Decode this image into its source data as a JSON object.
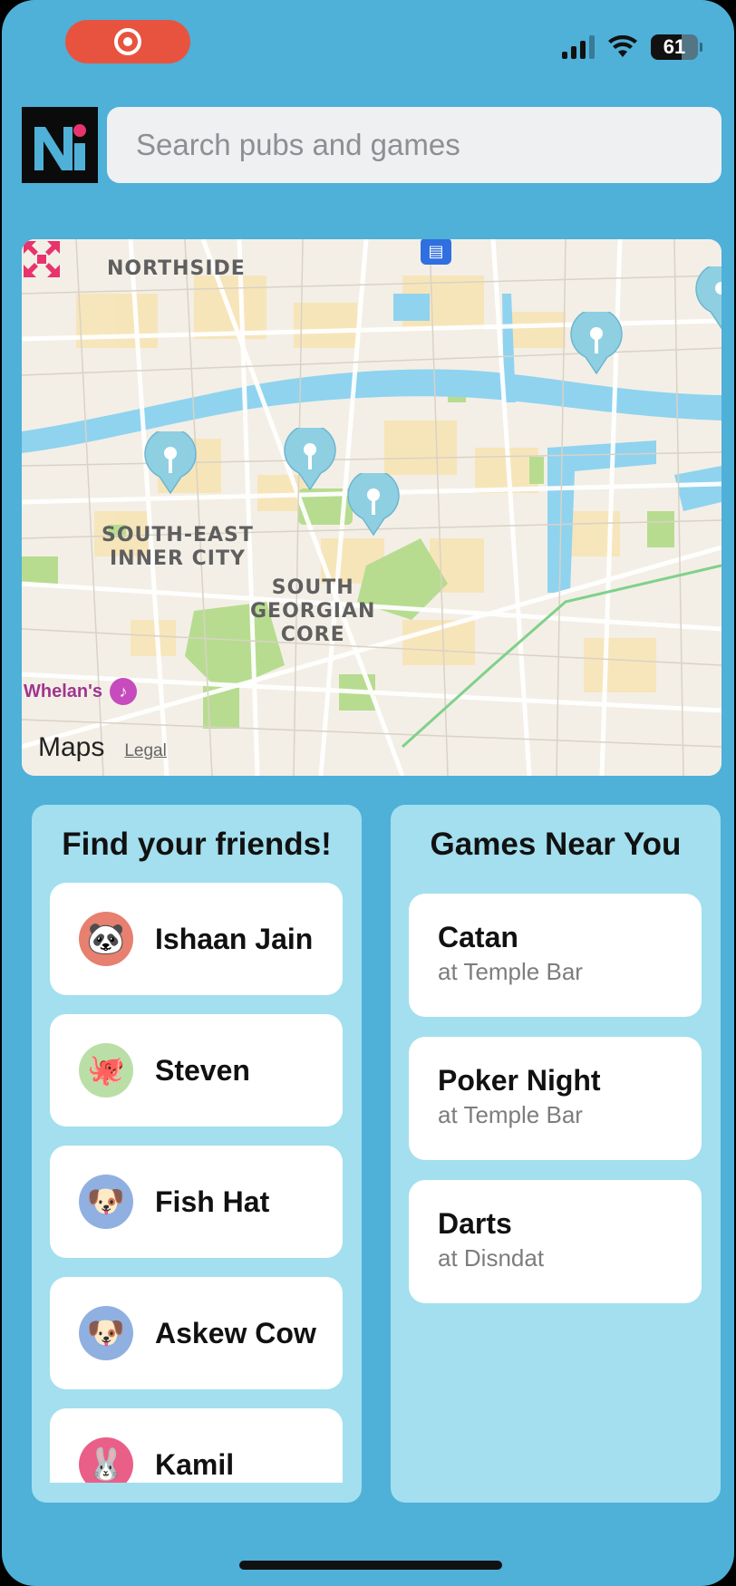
{
  "status_bar": {
    "recording_icon": "record-icon",
    "battery_level": "61",
    "signal_icon": "cellular-signal-icon",
    "wifi_icon": "wifi-icon"
  },
  "header": {
    "logo_icon": "app-logo-icon",
    "search_placeholder": "Search pubs and games"
  },
  "map": {
    "labels": {
      "northside": "NORTHSIDE",
      "south_east_line1": "SOUTH-EAST",
      "south_east_line2": "INNER CITY",
      "south_line1": "SOUTH",
      "south_line2": "GEORGIAN",
      "south_line3": "CORE"
    },
    "venue_label": "Whelan's",
    "brand": "Maps",
    "legal": "Legal",
    "pin_icon": "map-pin-icon",
    "expand_icon": "expand-icon",
    "colors": {
      "water": "#8fd3ef",
      "park": "#b7dc8f",
      "land": "#f3efe6",
      "road": "#ffffff"
    }
  },
  "friends": {
    "title": "Find your friends!",
    "items": [
      {
        "name": "Ishaan Jain",
        "avatar": "🐼",
        "avatar_bg": "#e7806f"
      },
      {
        "name": "Steven",
        "avatar": "🐙",
        "avatar_bg": "#b9dfa7"
      },
      {
        "name": "Fish Hat",
        "avatar": "🐶",
        "avatar_bg": "#8fb0e0"
      },
      {
        "name": "Askew Cow",
        "avatar": "🐶",
        "avatar_bg": "#8fb0e0"
      },
      {
        "name": "Kamil",
        "avatar": "🐰",
        "avatar_bg": "#ea5f87"
      }
    ]
  },
  "games": {
    "title": "Games Near You",
    "items": [
      {
        "name": "Catan",
        "venue": "at Temple Bar"
      },
      {
        "name": "Poker Night",
        "venue": "at Temple Bar"
      },
      {
        "name": "Darts",
        "venue": "at Disndat"
      }
    ]
  },
  "colors": {
    "background": "#4fb0d8",
    "panel": "#a3dfee",
    "record_pill": "#e8533f",
    "accent_pink": "#e8336d"
  }
}
